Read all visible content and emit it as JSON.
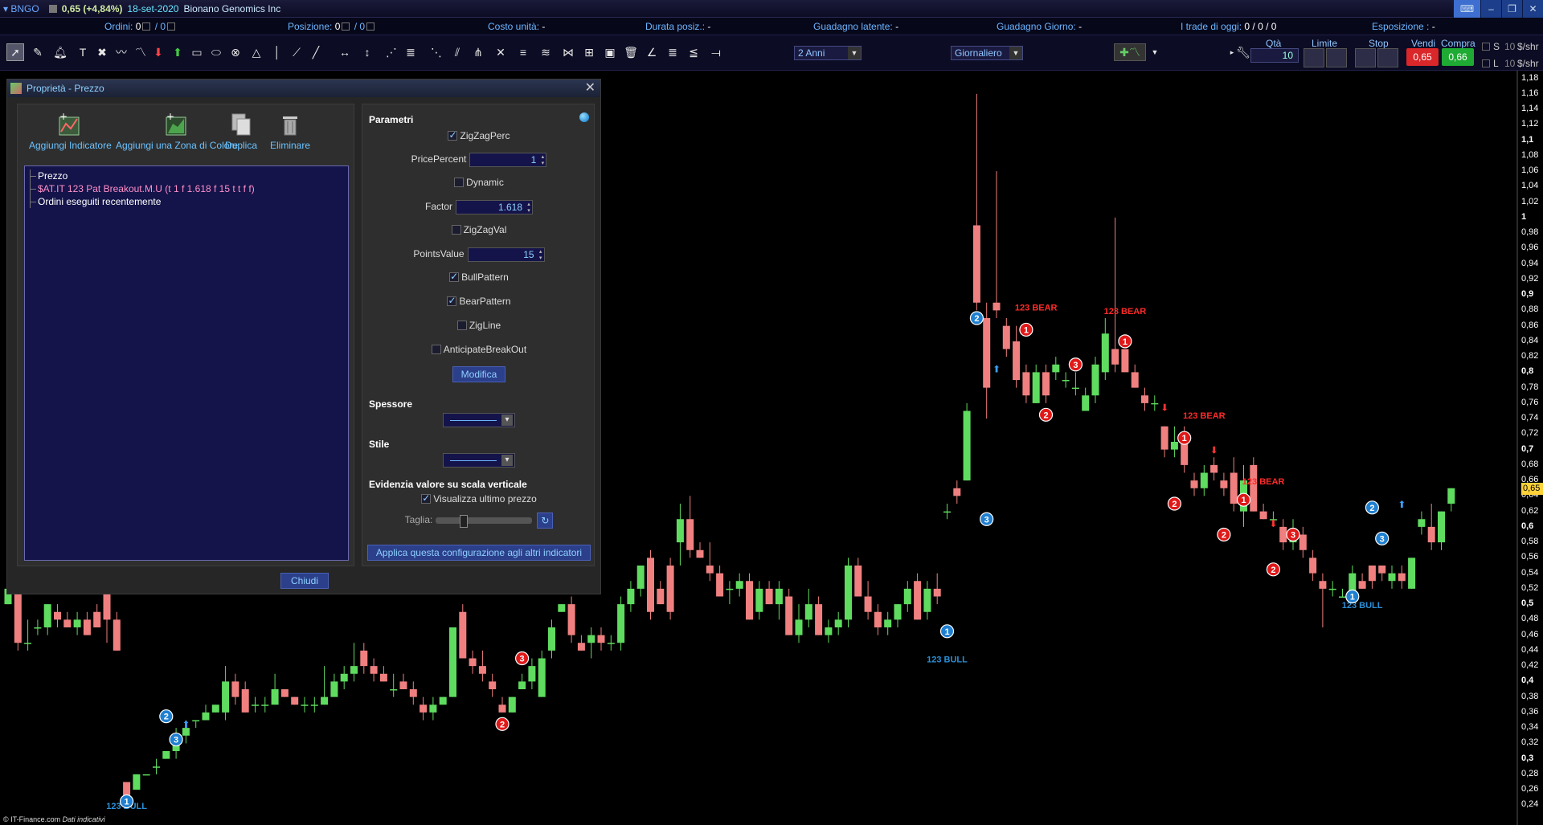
{
  "titlebar": {
    "symbol": "BNGO",
    "price": "0,65 (+4,84%)",
    "date": "18-set-2020",
    "company": "Bionano Genomics Inc"
  },
  "infobar": {
    "ordini_label": "Ordini:",
    "ordini_a": "0",
    "ordini_b": "/ 0",
    "posizione_label": "Posizione:",
    "posizione_a": "0",
    "posizione_b": "/ 0",
    "costo_label": "Costo unità:",
    "costo_value": "-",
    "durata_label": "Durata posiz.:",
    "durata_value": "-",
    "guad_lat_label": "Guadagno latente:",
    "guad_lat_value": "-",
    "guad_giorno_label": "Guadagno Giorno:",
    "guad_giorno_value": "-",
    "trade_label": "I trade di oggi:",
    "trade_value": "0 / 0 / 0",
    "espo_label": "Esposizione :",
    "espo_value": "-"
  },
  "toolbar": {
    "period": "2 Anni",
    "interval": "Giornaliero",
    "order": {
      "qta_label": "Qtà",
      "qta_value": "10",
      "limite_label": "Limite",
      "stop_label": "Stop",
      "vendi_label": "Vendi",
      "vendi_price": "0,65",
      "compra_label": "Compra",
      "compra_price": "0,66",
      "s_label": "S",
      "l_label": "L",
      "s_qty": "10",
      "l_qty": "10",
      "unit": "$/shr"
    }
  },
  "dialog": {
    "title": "Proprietà - Prezzo",
    "close": "✕",
    "buttons": {
      "add_indicator": "Aggiungi Indicatore",
      "add_zone": "Aggiungi una Zona di Colore",
      "duplicate": "Duplica",
      "delete": "Eliminare"
    },
    "tree": [
      "Prezzo",
      "$AT.IT 123 Pat Breakout.M.U (t 1 f 1.618 f 15 t t f f)",
      "Ordini eseguiti recentemente"
    ],
    "close_button": "Chiudi",
    "params": {
      "section": "Parametri",
      "zigzagperc": "ZigZagPerc",
      "pricepercent_label": "PricePercent",
      "pricepercent_value": "1",
      "dynamic": "Dynamic",
      "factor_label": "Factor",
      "factor_value": "1.618",
      "zigzagval": "ZigZagVal",
      "pointsvalue_label": "PointsValue",
      "pointsvalue_value": "15",
      "bullpattern": "BullPattern",
      "bearpattern": "BearPattern",
      "zigline": "ZigLine",
      "anticipate": "AnticipateBreakOut",
      "modifica": "Modifica",
      "spessore": "Spessore",
      "stile": "Stile",
      "evidenzia": "Evidenzia valore su scala verticale",
      "visualizza": "Visualizza ultimo prezzo",
      "taglia": "Taglia:",
      "applica": "Applica questa configurazione agli altri indicatori"
    }
  },
  "chart_data": {
    "type": "candlestick",
    "y_ticks": [
      "1,18",
      "1,16",
      "1,14",
      "1,12",
      "1,1",
      "1,08",
      "1,06",
      "1,04",
      "1,02",
      "1",
      "0,98",
      "0,96",
      "0,94",
      "0,92",
      "0,9",
      "0,88",
      "0,86",
      "0,84",
      "0,82",
      "0,8",
      "0,78",
      "0,76",
      "0,74",
      "0,72",
      "0,7",
      "0,68",
      "0,66",
      "0,64",
      "0,62",
      "0,6",
      "0,58",
      "0,56",
      "0,54",
      "0,52",
      "0,5",
      "0,48",
      "0,46",
      "0,44",
      "0,42",
      "0,4",
      "0,38",
      "0,36",
      "0,34",
      "0,32",
      "0,3",
      "0,28",
      "0,26",
      "0,24"
    ],
    "bold_ticks": [
      "1,1",
      "1",
      "0,9",
      "0,8",
      "0,7",
      "0,6",
      "0,5",
      "0,4",
      "0,3"
    ],
    "ylim": [
      0.23,
      1.19
    ],
    "last_price": "0,65",
    "bull_color": "#5fdc5f",
    "bear_color": "#f08080",
    "candles": [
      [
        0.5,
        0.52,
        0.5,
        0.52
      ],
      [
        0.52,
        0.52,
        0.44,
        0.45
      ],
      [
        0.45,
        0.48,
        0.44,
        0.45
      ],
      [
        0.47,
        0.48,
        0.46,
        0.47
      ],
      [
        0.47,
        0.5,
        0.46,
        0.5
      ],
      [
        0.49,
        0.5,
        0.47,
        0.48
      ],
      [
        0.48,
        0.49,
        0.47,
        0.47
      ],
      [
        0.47,
        0.49,
        0.46,
        0.48
      ],
      [
        0.48,
        0.49,
        0.46,
        0.46
      ],
      [
        0.49,
        0.5,
        0.47,
        0.47
      ],
      [
        0.52,
        0.52,
        0.45,
        0.48
      ],
      [
        0.48,
        0.49,
        0.44,
        0.44
      ],
      [
        0.27,
        0.27,
        0.25,
        0.25
      ],
      [
        0.26,
        0.28,
        0.26,
        0.28
      ],
      [
        0.28,
        0.28,
        0.28,
        0.28
      ],
      [
        0.29,
        0.3,
        0.28,
        0.29
      ],
      [
        0.3,
        0.31,
        0.3,
        0.31
      ],
      [
        0.31,
        0.34,
        0.3,
        0.33
      ],
      [
        0.33,
        0.35,
        0.32,
        0.34
      ],
      [
        0.35,
        0.35,
        0.34,
        0.35
      ],
      [
        0.35,
        0.37,
        0.35,
        0.36
      ],
      [
        0.36,
        0.37,
        0.36,
        0.37
      ],
      [
        0.36,
        0.42,
        0.35,
        0.4
      ],
      [
        0.4,
        0.41,
        0.37,
        0.38
      ],
      [
        0.39,
        0.4,
        0.36,
        0.36
      ],
      [
        0.37,
        0.38,
        0.36,
        0.37
      ],
      [
        0.37,
        0.38,
        0.36,
        0.37
      ],
      [
        0.37,
        0.41,
        0.37,
        0.39
      ],
      [
        0.39,
        0.39,
        0.38,
        0.38
      ],
      [
        0.38,
        0.38,
        0.37,
        0.37
      ],
      [
        0.37,
        0.38,
        0.36,
        0.37
      ],
      [
        0.37,
        0.38,
        0.36,
        0.37
      ],
      [
        0.37,
        0.42,
        0.37,
        0.38
      ],
      [
        0.38,
        0.41,
        0.38,
        0.4
      ],
      [
        0.4,
        0.42,
        0.39,
        0.41
      ],
      [
        0.41,
        0.45,
        0.4,
        0.42
      ],
      [
        0.44,
        0.45,
        0.41,
        0.42
      ],
      [
        0.42,
        0.43,
        0.4,
        0.41
      ],
      [
        0.41,
        0.42,
        0.4,
        0.4
      ],
      [
        0.39,
        0.41,
        0.38,
        0.39
      ],
      [
        0.4,
        0.41,
        0.39,
        0.39
      ],
      [
        0.39,
        0.4,
        0.37,
        0.38
      ],
      [
        0.37,
        0.38,
        0.35,
        0.36
      ],
      [
        0.36,
        0.38,
        0.35,
        0.37
      ],
      [
        0.37,
        0.38,
        0.37,
        0.38
      ],
      [
        0.38,
        0.47,
        0.38,
        0.47
      ],
      [
        0.49,
        0.5,
        0.43,
        0.43
      ],
      [
        0.43,
        0.44,
        0.41,
        0.42
      ],
      [
        0.42,
        0.44,
        0.4,
        0.41
      ],
      [
        0.4,
        0.41,
        0.38,
        0.39
      ],
      [
        0.37,
        0.38,
        0.36,
        0.36
      ],
      [
        0.36,
        0.38,
        0.36,
        0.38
      ],
      [
        0.39,
        0.41,
        0.39,
        0.4
      ],
      [
        0.4,
        0.43,
        0.39,
        0.42
      ],
      [
        0.38,
        0.44,
        0.38,
        0.43
      ],
      [
        0.44,
        0.48,
        0.43,
        0.47
      ],
      [
        0.49,
        0.5,
        0.49,
        0.5
      ],
      [
        0.5,
        0.51,
        0.45,
        0.46
      ],
      [
        0.45,
        0.46,
        0.44,
        0.44
      ],
      [
        0.45,
        0.47,
        0.43,
        0.46
      ],
      [
        0.46,
        0.47,
        0.44,
        0.45
      ],
      [
        0.45,
        0.46,
        0.44,
        0.45
      ],
      [
        0.45,
        0.51,
        0.44,
        0.5
      ],
      [
        0.5,
        0.53,
        0.49,
        0.52
      ],
      [
        0.52,
        0.55,
        0.51,
        0.55
      ],
      [
        0.56,
        0.57,
        0.48,
        0.49
      ],
      [
        0.52,
        0.53,
        0.5,
        0.5
      ],
      [
        0.55,
        0.56,
        0.48,
        0.49
      ],
      [
        0.58,
        0.63,
        0.55,
        0.61
      ],
      [
        0.61,
        0.64,
        0.56,
        0.57
      ],
      [
        0.57,
        0.58,
        0.56,
        0.56
      ],
      [
        0.55,
        0.58,
        0.53,
        0.54
      ],
      [
        0.54,
        0.55,
        0.51,
        0.51
      ],
      [
        0.52,
        0.53,
        0.5,
        0.52
      ],
      [
        0.52,
        0.54,
        0.51,
        0.53
      ],
      [
        0.53,
        0.54,
        0.48,
        0.48
      ],
      [
        0.49,
        0.53,
        0.48,
        0.52
      ],
      [
        0.52,
        0.53,
        0.5,
        0.5
      ],
      [
        0.5,
        0.53,
        0.48,
        0.52
      ],
      [
        0.51,
        0.52,
        0.46,
        0.46
      ],
      [
        0.46,
        0.5,
        0.45,
        0.48
      ],
      [
        0.48,
        0.52,
        0.47,
        0.5
      ],
      [
        0.5,
        0.51,
        0.46,
        0.46
      ],
      [
        0.46,
        0.48,
        0.45,
        0.47
      ],
      [
        0.47,
        0.49,
        0.46,
        0.48
      ],
      [
        0.48,
        0.56,
        0.47,
        0.55
      ],
      [
        0.55,
        0.56,
        0.51,
        0.51
      ],
      [
        0.51,
        0.53,
        0.48,
        0.49
      ],
      [
        0.49,
        0.5,
        0.46,
        0.47
      ],
      [
        0.47,
        0.49,
        0.46,
        0.48
      ],
      [
        0.48,
        0.5,
        0.47,
        0.5
      ],
      [
        0.5,
        0.53,
        0.49,
        0.52
      ],
      [
        0.53,
        0.54,
        0.48,
        0.48
      ],
      [
        0.49,
        0.53,
        0.48,
        0.52
      ],
      [
        0.52,
        0.54,
        0.5,
        0.51
      ],
      [
        0.62,
        0.63,
        0.61,
        0.62
      ],
      [
        0.65,
        0.66,
        0.63,
        0.64
      ],
      [
        0.66,
        0.76,
        0.66,
        0.75
      ],
      [
        0.99,
        1.16,
        0.88,
        0.89
      ],
      [
        0.87,
        0.89,
        0.74,
        0.78
      ],
      [
        0.89,
        1.06,
        0.87,
        0.88
      ],
      [
        0.86,
        0.87,
        0.82,
        0.83
      ],
      [
        0.84,
        0.86,
        0.78,
        0.79
      ],
      [
        0.8,
        0.81,
        0.76,
        0.77
      ],
      [
        0.76,
        0.81,
        0.76,
        0.8
      ],
      [
        0.8,
        0.81,
        0.76,
        0.77
      ],
      [
        0.8,
        0.82,
        0.79,
        0.81
      ],
      [
        0.79,
        0.8,
        0.78,
        0.79
      ],
      [
        0.78,
        0.8,
        0.77,
        0.78
      ],
      [
        0.75,
        0.78,
        0.75,
        0.77
      ],
      [
        0.77,
        0.82,
        0.76,
        0.81
      ],
      [
        0.8,
        0.87,
        0.79,
        0.85
      ],
      [
        0.83,
        1.0,
        0.8,
        0.81
      ],
      [
        0.83,
        0.83,
        0.8,
        0.8
      ],
      [
        0.8,
        0.81,
        0.78,
        0.78
      ],
      [
        0.77,
        0.78,
        0.75,
        0.76
      ],
      [
        0.76,
        0.77,
        0.75,
        0.76
      ],
      [
        0.73,
        0.73,
        0.69,
        0.7
      ],
      [
        0.7,
        0.73,
        0.69,
        0.71
      ],
      [
        0.72,
        0.73,
        0.67,
        0.68
      ],
      [
        0.66,
        0.67,
        0.64,
        0.65
      ],
      [
        0.65,
        0.68,
        0.64,
        0.67
      ],
      [
        0.68,
        0.69,
        0.66,
        0.67
      ],
      [
        0.66,
        0.67,
        0.64,
        0.65
      ],
      [
        0.67,
        0.69,
        0.62,
        0.63
      ],
      [
        0.62,
        0.68,
        0.6,
        0.66
      ],
      [
        0.68,
        0.69,
        0.62,
        0.62
      ],
      [
        0.62,
        0.63,
        0.61,
        0.61
      ],
      [
        0.61,
        0.62,
        0.6,
        0.61
      ],
      [
        0.6,
        0.61,
        0.57,
        0.58
      ],
      [
        0.58,
        0.61,
        0.57,
        0.59
      ],
      [
        0.59,
        0.6,
        0.56,
        0.57
      ],
      [
        0.56,
        0.57,
        0.53,
        0.54
      ],
      [
        0.53,
        0.54,
        0.47,
        0.52
      ],
      [
        0.52,
        0.53,
        0.51,
        0.52
      ],
      [
        0.51,
        0.52,
        0.51,
        0.51
      ],
      [
        0.51,
        0.55,
        0.51,
        0.54
      ],
      [
        0.53,
        0.54,
        0.52,
        0.52
      ],
      [
        0.55,
        0.55,
        0.52,
        0.53
      ],
      [
        0.55,
        0.55,
        0.53,
        0.54
      ],
      [
        0.53,
        0.55,
        0.52,
        0.54
      ],
      [
        0.54,
        0.55,
        0.52,
        0.53
      ],
      [
        0.52,
        0.56,
        0.52,
        0.56
      ],
      [
        0.6,
        0.62,
        0.59,
        0.61
      ],
      [
        0.6,
        0.63,
        0.57,
        0.58
      ],
      [
        0.58,
        0.62,
        0.57,
        0.62
      ],
      [
        0.63,
        0.65,
        0.62,
        0.65
      ]
    ],
    "markers": [
      {
        "label": "1",
        "type": "bull",
        "candle": 12,
        "y": 0.245
      },
      {
        "label": "2",
        "type": "bull",
        "candle": 16,
        "y": 0.355
      },
      {
        "label": "3",
        "type": "bull",
        "candle": 17,
        "y": 0.325
      },
      {
        "label": "2",
        "type": "bear",
        "candle": 50,
        "y": 0.345
      },
      {
        "label": "3",
        "type": "bear",
        "candle": 52,
        "y": 0.43
      },
      {
        "label": "1",
        "type": "bull",
        "candle": 95,
        "y": 0.465
      },
      {
        "label": "2",
        "type": "bull",
        "candle": 98,
        "y": 0.87
      },
      {
        "label": "3",
        "type": "bull",
        "candle": 99,
        "y": 0.61
      },
      {
        "label": "1",
        "type": "bear",
        "candle": 103,
        "y": 0.855
      },
      {
        "label": "2",
        "type": "bear",
        "candle": 105,
        "y": 0.745
      },
      {
        "label": "3",
        "type": "bear",
        "candle": 108,
        "y": 0.81
      },
      {
        "label": "1",
        "type": "bear",
        "candle": 113,
        "y": 0.84
      },
      {
        "label": "1",
        "type": "bear",
        "candle": 119,
        "y": 0.715
      },
      {
        "label": "2",
        "type": "bear",
        "candle": 118,
        "y": 0.63
      },
      {
        "label": "1",
        "type": "bear",
        "candle": 125,
        "y": 0.635
      },
      {
        "label": "2",
        "type": "bear",
        "candle": 123,
        "y": 0.59
      },
      {
        "label": "2",
        "type": "bear",
        "candle": 128,
        "y": 0.545
      },
      {
        "label": "3",
        "type": "bear",
        "candle": 130,
        "y": 0.59
      },
      {
        "label": "1",
        "type": "bull",
        "candle": 136,
        "y": 0.51
      },
      {
        "label": "2",
        "type": "bull",
        "candle": 138,
        "y": 0.625
      },
      {
        "label": "3",
        "type": "bull",
        "candle": 139,
        "y": 0.585
      }
    ],
    "pattern_labels": [
      {
        "text": "123 BULL",
        "type": "bull",
        "candle": 12,
        "y": 0.235
      },
      {
        "text": "123 BULL",
        "type": "bull",
        "candle": 95,
        "y": 0.425
      },
      {
        "text": "123 BULL",
        "type": "bull",
        "candle": 137,
        "y": 0.495
      },
      {
        "text": "123 BEAR",
        "type": "bear",
        "candle": 104,
        "y": 0.88
      },
      {
        "text": "123 BEAR",
        "type": "bear",
        "candle": 113,
        "y": 0.875
      },
      {
        "text": "123 BEAR",
        "type": "bear",
        "candle": 121,
        "y": 0.74
      },
      {
        "text": "123 BEAR",
        "type": "bear",
        "candle": 127,
        "y": 0.655
      }
    ],
    "arrows": [
      {
        "type": "up",
        "candle": 18,
        "y": 0.34
      },
      {
        "type": "up",
        "candle": 100,
        "y": 0.8
      },
      {
        "type": "down",
        "candle": 117,
        "y": 0.75
      },
      {
        "type": "down",
        "candle": 122,
        "y": 0.695
      },
      {
        "type": "down",
        "candle": 128,
        "y": 0.6
      },
      {
        "type": "up",
        "candle": 141,
        "y": 0.625
      }
    ]
  },
  "footer": {
    "source": "© IT-Finance.com",
    "note": "Dati indicativi"
  }
}
